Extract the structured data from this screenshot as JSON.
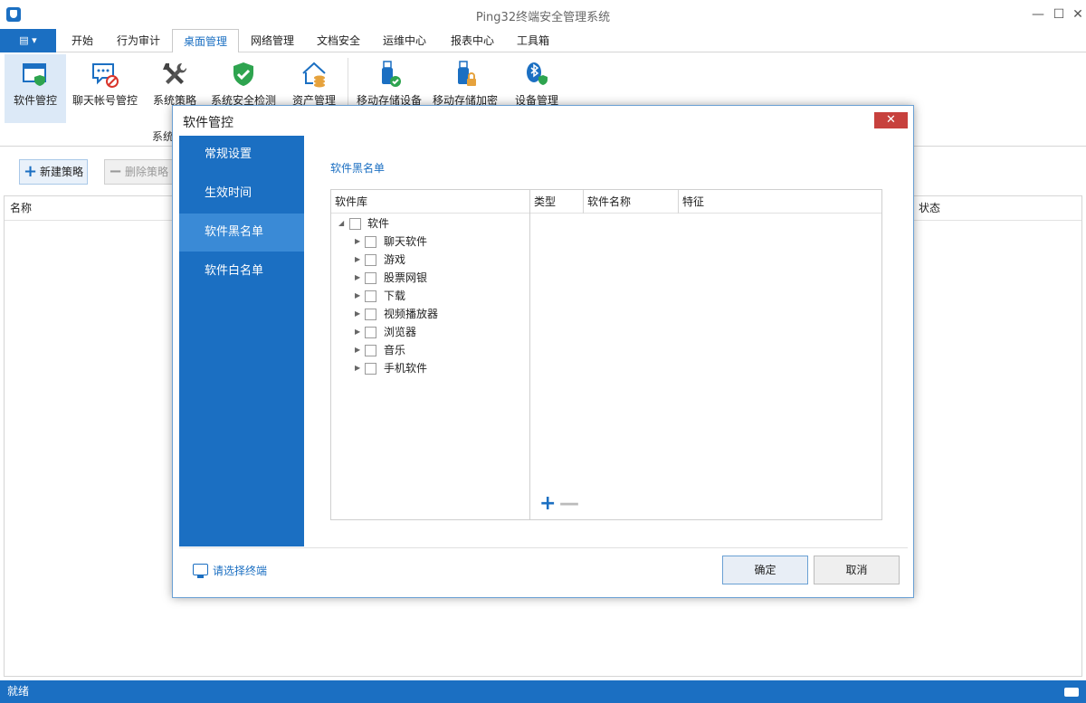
{
  "window": {
    "title": "Ping32终端安全管理系统",
    "controls": {
      "minimize": "—",
      "maximize": "☐",
      "close": "✕"
    }
  },
  "menu": {
    "file_label": "▤ ▾",
    "tabs": [
      "开始",
      "行为审计",
      "桌面管理",
      "网络管理",
      "文档安全",
      "运维中心",
      "报表中心",
      "工具箱"
    ],
    "active_tab": "桌面管理"
  },
  "ribbon": {
    "items": [
      {
        "label": "软件管控",
        "icon": "window-shield-icon"
      },
      {
        "label": "聊天帐号管控",
        "icon": "chat-blocked-icon"
      },
      {
        "label": "系统策略",
        "icon": "tools-icon"
      },
      {
        "label": "系统安全检测",
        "icon": "shield-check-icon"
      },
      {
        "label": "资产管理",
        "icon": "house-coins-icon"
      },
      {
        "label": "移动存储设备",
        "icon": "usb-check-icon"
      },
      {
        "label": "移动存储加密",
        "icon": "usb-lock-icon"
      },
      {
        "label": "设备管理",
        "icon": "bluetooth-shield-icon"
      }
    ],
    "group_label": "系统"
  },
  "toolbar": {
    "new_policy": "新建策略",
    "delete_policy": "删除策略"
  },
  "main_table": {
    "columns": [
      "名称",
      "状态"
    ]
  },
  "status": {
    "text": "就绪"
  },
  "dialog": {
    "title": "软件管控",
    "close_glyph": "✕",
    "nav": [
      "常规设置",
      "生效时间",
      "软件黑名单",
      "软件白名单"
    ],
    "active_nav": "软件黑名单",
    "section_title": "软件黑名单",
    "library": {
      "header": "软件库",
      "root": "软件",
      "children": [
        "聊天软件",
        "游戏",
        "股票网银",
        "下载",
        "视频播放器",
        "浏览器",
        "音乐",
        "手机软件"
      ]
    },
    "list_columns": [
      "类型",
      "软件名称",
      "特征"
    ],
    "add_glyph": "+",
    "remove_glyph": "—",
    "select_terminal": "请选择终端",
    "ok": "确定",
    "cancel": "取消"
  },
  "colors": {
    "accent": "#1b6fc2",
    "nav_active": "#3a8ad6",
    "close_red": "#c7413d"
  }
}
